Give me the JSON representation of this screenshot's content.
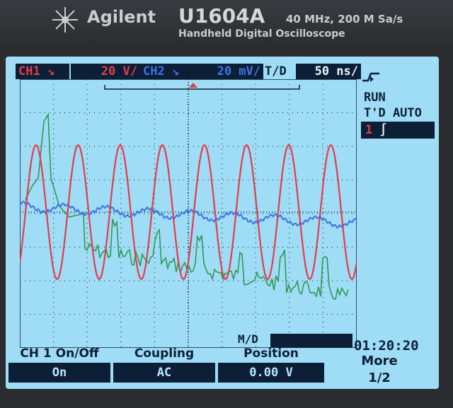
{
  "device": {
    "brand": "Agilent",
    "model": "U1604A",
    "spec": "40 MHz, 200 M Sa/s",
    "description": "Handheld Digital Oscilloscope"
  },
  "header": {
    "ch1_label": "CH1",
    "ch1_scale": "20 V/",
    "ch2_label": "CH2",
    "ch2_scale": "20 mV/",
    "timebase_label": "T/D",
    "timebase_value": "50 ns/"
  },
  "status": {
    "run_state": "RUN",
    "trigger_mode": "T'D AUTO",
    "trigger_source": "1"
  },
  "bottom": {
    "md_label": "M/D",
    "clock": "01:20:20"
  },
  "softkeys": [
    {
      "title": "CH 1 On/Off",
      "value": "On"
    },
    {
      "title": "Coupling",
      "value": "AC"
    },
    {
      "title": "Position",
      "value": "0.00    V"
    },
    {
      "title": "More",
      "value": "1/2"
    }
  ],
  "colors": {
    "ch1": "#e33d49",
    "ch2": "#3a74e8",
    "ch3": "#2f9a55",
    "screen_bg": "#9fdcf5",
    "panel_dark": "#0d1f36"
  },
  "chart_data": {
    "type": "line",
    "grid": true,
    "series": [
      {
        "id": "ch1",
        "trace": "sine",
        "cycles": 8
      },
      {
        "id": "ch2",
        "trace": "ripple"
      },
      {
        "id": "math",
        "trace": "noisy-step"
      }
    ]
  }
}
